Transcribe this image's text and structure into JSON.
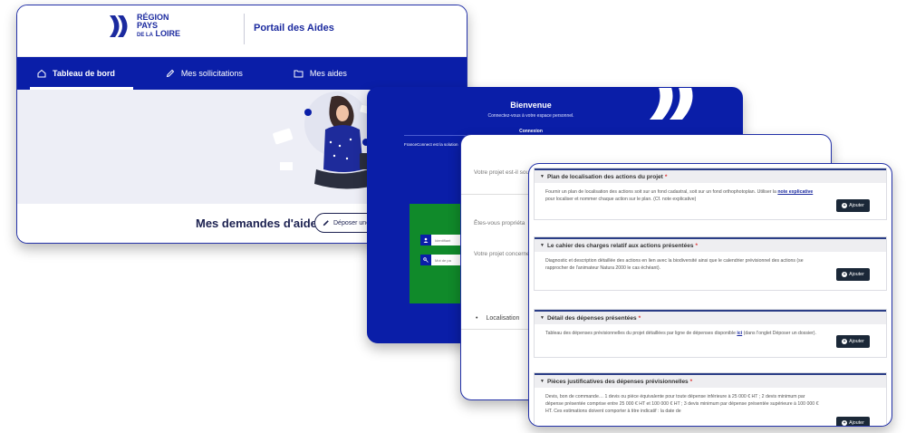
{
  "portal": {
    "logo_line1": "RÉGION",
    "logo_line2": "PAYS",
    "logo_line3_small": "DE LA",
    "logo_line3": "LOIRE",
    "title": "Portail des Aides",
    "nav": [
      {
        "label": "Tableau de bord",
        "icon": "home-icon"
      },
      {
        "label": "Mes sollicitations",
        "icon": "pen-icon"
      },
      {
        "label": "Mes aides",
        "icon": "folder-icon"
      }
    ],
    "requests_title": "Mes demandes d'aides",
    "deposit_label": "Déposer une de"
  },
  "login": {
    "welcome": "Bienvenue",
    "subtitle": "Connectez-vous à votre espace personnel.",
    "connexion": "Connexion",
    "franceconnect": "FranceConnect est la solution",
    "identifier_placeholder": "Identifiant",
    "password_placeholder": "Mot de pa"
  },
  "questionnaire": {
    "q1": "Votre projet est-il soumis à",
    "q2": "Êtes-vous propriéta",
    "q3": "Votre projet concerne",
    "localisation": "Localisation"
  },
  "documents": {
    "add_label": "Ajouter",
    "sections": [
      {
        "title": "Plan de localisation des actions du projet",
        "required_mark": "*",
        "body_before": "Fournir un plan de localisation des actions soit sur un fond cadastral, soit sur un fond orthophotoplan. Utiliser la ",
        "body_link": "note explicative",
        "body_after": " pour localiser et nommer chaque action sur le plan. (Cf. note explicative)"
      },
      {
        "title": "Le cahier des charges relatif aux actions présentées",
        "required_mark": " *",
        "body_before": "Diagnostic et description détaillée des actions en lien avec la biodiversité ainsi que le calendrier prévisionnel des actions (se rapprocher de l'animateur Natura 2000 le cas échéant).",
        "body_link": "",
        "body_after": ""
      },
      {
        "title": "Détail des dépenses présentées",
        "required_mark": "*",
        "body_before": "Tableau des dépenses prévisionnelles du projet détaillées par ligne de dépenses disponible ",
        "body_link": "ici",
        "body_after": " (dans l'onglet Déposer un dossier)."
      },
      {
        "title": "Pièces justificatives des dépenses prévisionnelles",
        "required_mark": "  *",
        "body_before": "Devis, bon de commande… 1 devis ou pièce équivalente pour toute dépense inférieure à 25 000 € HT ; 2 devis minimum par dépense présentée comprise entre 25 000 € HT et 100 000 € HT ; 3 devis minimum par dépense présentée supérieure à 100 000 € HT. Ces estimations doivent comporter à titre indicatif : la date de",
        "body_link": "",
        "body_after": ""
      }
    ]
  },
  "colors": {
    "brand_blue": "#0a1ea8",
    "green": "#108a2a",
    "dark_button": "#1b2838"
  }
}
